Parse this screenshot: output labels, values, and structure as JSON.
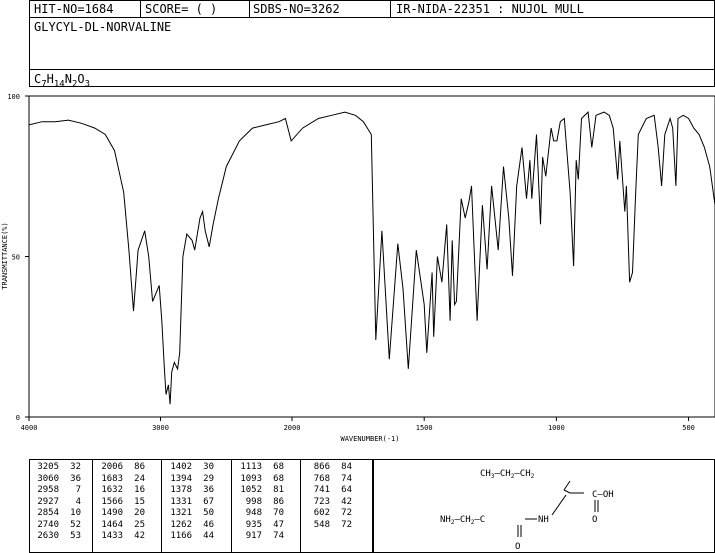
{
  "header": {
    "hit_no": "HIT-NO=1684",
    "score": "SCORE=  (   )",
    "sdbs_no": "SDBS-NO=3262",
    "ir_info": "IR-NIDA-22351 : NUJOL MULL"
  },
  "compound": {
    "name": "GLYCYL-DL-NORVALINE",
    "formula_parts": [
      "C",
      "7",
      "H",
      "14",
      "N",
      "2",
      "O",
      "3"
    ]
  },
  "chart_data": {
    "type": "line",
    "xlabel": "WAVENUMBER(-1)",
    "ylabel": "TRANSMITTANCE(%)",
    "xlim": [
      4000,
      400
    ],
    "ylim": [
      0,
      100
    ],
    "x_ticks": [
      4000,
      3000,
      2000,
      1500,
      1000,
      500
    ],
    "x_tick_labels": [
      "4000",
      "3000",
      "2000",
      "1500",
      "1000",
      "500"
    ],
    "y_ticks": [
      0,
      50,
      100
    ],
    "y_tick_labels": [
      "0",
      "50",
      "100"
    ],
    "series": [
      {
        "x": [
          4000,
          3900,
          3800,
          3700,
          3600,
          3500,
          3420,
          3350,
          3280,
          3240,
          3205,
          3170,
          3120,
          3090,
          3060,
          3010,
          2990,
          2970,
          2958,
          2940,
          2927,
          2915,
          2895,
          2870,
          2854,
          2830,
          2800,
          2760,
          2740,
          2700,
          2680,
          2660,
          2630,
          2600,
          2560,
          2500,
          2400,
          2300,
          2200,
          2100,
          2050,
          2006,
          1960,
          1900,
          1850,
          1800,
          1760,
          1730,
          1700,
          1683,
          1660,
          1632,
          1600,
          1580,
          1560,
          1530,
          1500,
          1490,
          1470,
          1464,
          1450,
          1433,
          1415,
          1402,
          1394,
          1385,
          1378,
          1360,
          1345,
          1331,
          1321,
          1300,
          1280,
          1262,
          1245,
          1220,
          1200,
          1180,
          1166,
          1150,
          1130,
          1113,
          1100,
          1093,
          1075,
          1060,
          1052,
          1040,
          1020,
          1010,
          998,
          985,
          970,
          948,
          935,
          925,
          917,
          905,
          880,
          866,
          850,
          820,
          800,
          785,
          768,
          760,
          741,
          735,
          723,
          712,
          700,
          690,
          660,
          630,
          615,
          602,
          590,
          570,
          560,
          548,
          540,
          520,
          500,
          480,
          460,
          440,
          420,
          400
        ],
        "y": [
          91,
          92,
          92,
          92.5,
          91.5,
          90,
          88,
          83,
          70,
          52,
          33,
          52,
          58,
          50,
          36,
          41,
          30,
          15,
          7,
          10,
          4,
          14,
          17,
          15,
          20,
          50,
          57,
          55,
          52,
          62,
          64,
          58,
          53,
          60,
          68,
          78,
          86,
          90,
          91,
          92,
          93,
          86,
          90,
          93,
          94,
          95,
          94,
          92,
          88,
          24,
          58,
          18,
          54,
          40,
          15,
          52,
          35,
          20,
          45,
          25,
          50,
          42,
          60,
          30,
          55,
          35,
          36,
          68,
          62,
          67,
          72,
          30,
          66,
          46,
          72,
          52,
          78,
          62,
          44,
          72,
          84,
          68,
          80,
          68,
          88,
          60,
          81,
          75,
          90,
          86,
          86,
          92,
          93,
          70,
          47,
          80,
          74,
          93,
          95,
          84,
          94,
          95,
          94,
          90,
          74,
          86,
          64,
          72,
          42,
          45,
          70,
          88,
          93,
          94,
          84,
          72,
          88,
          93,
          90,
          72,
          93,
          94,
          93,
          90,
          88,
          84,
          78,
          66
        ]
      }
    ],
    "peak_table": [
      [
        "3205",
        "32"
      ],
      [
        "3060",
        "36"
      ],
      [
        "2958",
        "7"
      ],
      [
        "2927",
        "4"
      ],
      [
        "2854",
        "10"
      ],
      [
        "2740",
        "52"
      ],
      [
        "2630",
        "53"
      ],
      [
        "2006",
        "86"
      ],
      [
        "1683",
        "24"
      ],
      [
        "1632",
        "16"
      ],
      [
        "1566",
        "15"
      ],
      [
        "1490",
        "20"
      ],
      [
        "1464",
        "25"
      ],
      [
        "1433",
        "42"
      ],
      [
        "1402",
        "30"
      ],
      [
        "1394",
        "29"
      ],
      [
        "1378",
        "36"
      ],
      [
        "1331",
        "67"
      ],
      [
        "1321",
        "50"
      ],
      [
        "1262",
        "46"
      ],
      [
        "1166",
        "44"
      ],
      [
        "1113",
        "68"
      ],
      [
        "1093",
        "68"
      ],
      [
        "1052",
        "81"
      ],
      [
        "998",
        "86"
      ],
      [
        "948",
        "70"
      ],
      [
        "935",
        "47"
      ],
      [
        "917",
        "74"
      ],
      [
        "866",
        "84"
      ],
      [
        "768",
        "74"
      ],
      [
        "741",
        "64"
      ],
      [
        "723",
        "42"
      ],
      [
        "602",
        "72"
      ],
      [
        "548",
        "72"
      ]
    ]
  },
  "structure": {
    "top_chain": "CH3 CH2 CH2",
    "acid": "COOH",
    "amine": "NH2",
    "nh": "NH",
    "o": "O"
  }
}
